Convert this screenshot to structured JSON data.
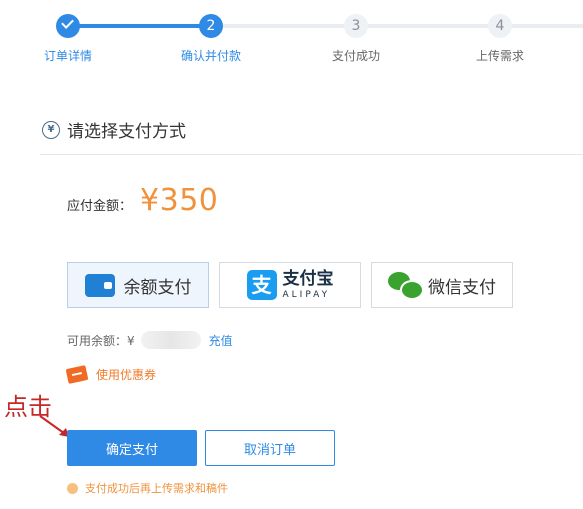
{
  "stepper": {
    "steps": [
      {
        "number": "",
        "label": "订单详情",
        "state": "done"
      },
      {
        "number": "2",
        "label": "确认并付款",
        "state": "active"
      },
      {
        "number": "3",
        "label": "支付成功",
        "state": "todo"
      },
      {
        "number": "4",
        "label": "上传需求",
        "state": "todo"
      }
    ]
  },
  "section": {
    "title": "请选择支付方式",
    "icon": "yen-circle-icon"
  },
  "amount": {
    "label": "应付金额：",
    "value": "¥350"
  },
  "methods": {
    "balance": {
      "label": "余额支付",
      "icon": "wallet-icon",
      "selected": true
    },
    "alipay": {
      "label_cn": "支付宝",
      "label_en": "ALIPAY",
      "icon": "alipay-icon"
    },
    "wechat": {
      "label": "微信支付",
      "icon": "wechat-icon"
    }
  },
  "balance": {
    "label": "可用余额：¥",
    "recharge": "充值"
  },
  "coupon": {
    "label": "使用优惠券",
    "icon": "ticket-icon"
  },
  "annotation": {
    "text": "点击"
  },
  "buttons": {
    "confirm": "确定支付",
    "cancel": "取消订单"
  },
  "notice": {
    "text": "支付成功后再上传需求和稿件"
  },
  "colors": {
    "primary": "#2f8ae5",
    "accent": "#f0923c",
    "annotation": "#c62828"
  }
}
